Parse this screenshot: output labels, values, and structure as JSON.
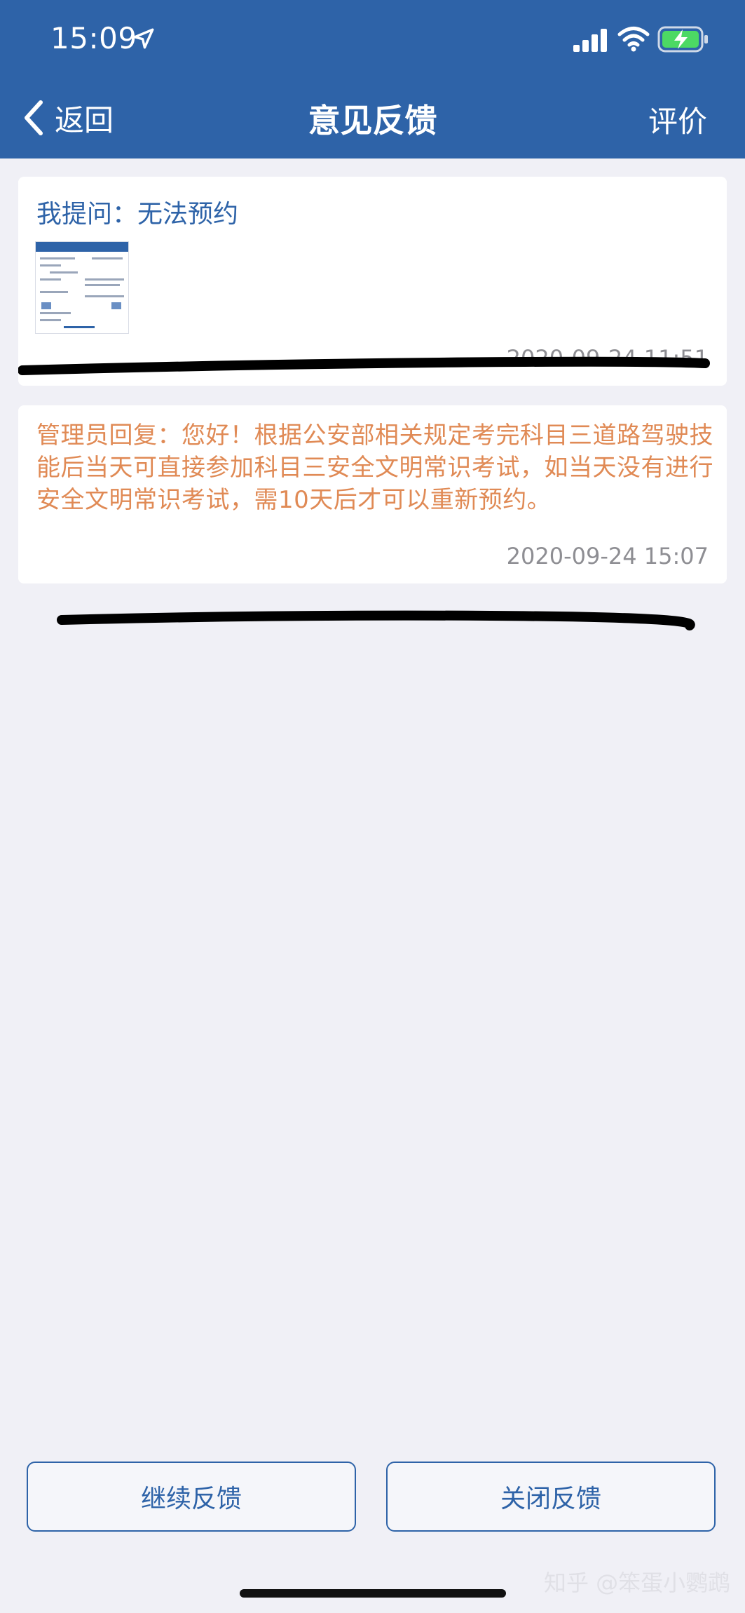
{
  "status_bar": {
    "time": "15:09",
    "icons": [
      "location-arrow-icon",
      "signal-icon",
      "wifi-icon",
      "battery-charging-icon"
    ]
  },
  "nav": {
    "back_label": "返回",
    "title": "意见反馈",
    "rate_label": "评价"
  },
  "question": {
    "title": "我提问：无法预约",
    "time": "2020-09-24 11:51",
    "attachment": "screenshot-thumbnail"
  },
  "reply": {
    "text": "管理员回复：您好！根据公安部相关规定考完科目三道路驾驶技能后当天可直接参加科目三安全文明常识考试，如当天没有进行安全文明常识考试，需10天后才可以重新预约。",
    "time": "2020-09-24 15:07"
  },
  "buttons": {
    "continue_label": "继续反馈",
    "close_label": "关闭反馈"
  },
  "watermark": "知乎 @笨蛋小鹦鹉",
  "colors": {
    "header": "#2e63a8",
    "reply_text": "#e08a55",
    "background": "#f0f0f6"
  }
}
